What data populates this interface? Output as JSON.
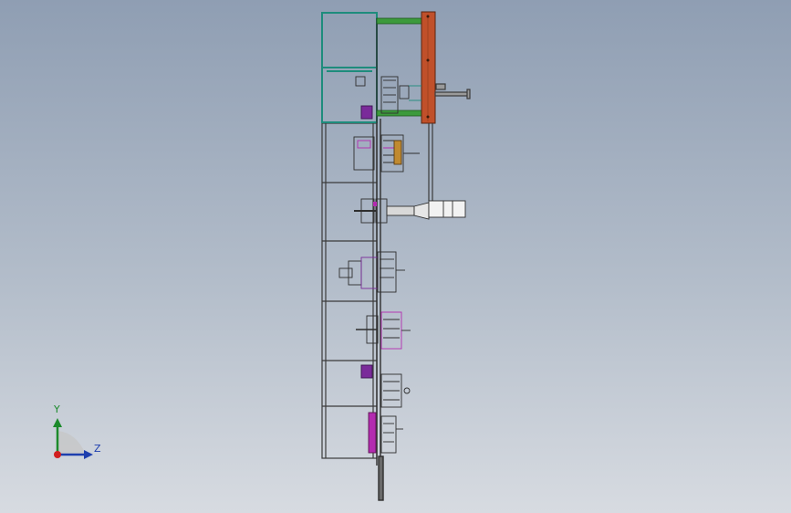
{
  "viewport": {
    "background_top": "#8f9eb3",
    "background_bottom": "#d7dbe1"
  },
  "model": {
    "frame_color": "#3b3b3b",
    "accent_teal": "#1e8c7c",
    "accent_green": "#3c9a3c",
    "accent_orange": "#c0502a",
    "accent_magenta": "#b32bb0",
    "accent_purple": "#7a2b9a"
  },
  "triad": {
    "y_label": "Y",
    "z_label": "Z",
    "y_color": "#1b8a2b",
    "z_color": "#1e3fae",
    "origin_color": "#d11f1f"
  }
}
